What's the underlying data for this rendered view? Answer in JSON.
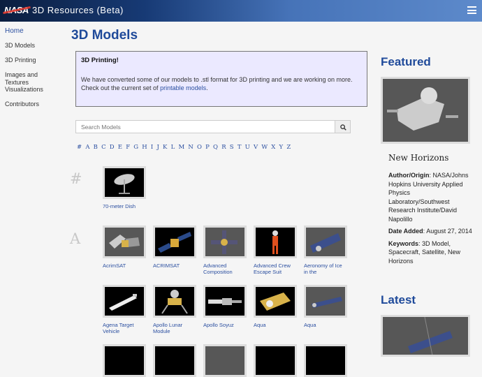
{
  "header": {
    "logo": "NASA",
    "title": "3D Resources (Beta)"
  },
  "sidebar": {
    "items": [
      {
        "label": "Home"
      },
      {
        "label": "3D Models"
      },
      {
        "label": "3D Printing"
      },
      {
        "label": "Images and Textures"
      },
      {
        "label": "Visualizations"
      },
      {
        "label": "Contributors"
      }
    ]
  },
  "main": {
    "title": "3D Models",
    "alert": {
      "heading": "3D Printing!",
      "text": "We have converted some of our models to .stl format for 3D printing and we are working on more. Check out the current set of",
      "link": "printable models",
      "end": "."
    },
    "search": {
      "placeholder": "Search Models"
    },
    "alphabet": [
      "#",
      "A",
      "B",
      "C",
      "D",
      "E",
      "F",
      "G",
      "H",
      "I",
      "J",
      "K",
      "L",
      "M",
      "N",
      "O",
      "P",
      "Q",
      "R",
      "S",
      "T",
      "U",
      "V",
      "W",
      "X",
      "Y",
      "Z"
    ],
    "sections": [
      {
        "letter": "#",
        "models": [
          {
            "name": "70-meter Dish"
          }
        ]
      },
      {
        "letter": "A",
        "models": [
          {
            "name": "AcrimSAT"
          },
          {
            "name": "ACRIMSAT"
          },
          {
            "name": "Advanced Composition"
          },
          {
            "name": "Advanced Crew Escape Suit"
          },
          {
            "name": "Aeronomy of Ice in the"
          },
          {
            "name": "Agena Target Vehicle"
          },
          {
            "name": "Apollo Lunar Module"
          },
          {
            "name": "Apollo Soyuz"
          },
          {
            "name": "Aqua"
          },
          {
            "name": "Aqua"
          }
        ]
      }
    ]
  },
  "featured": {
    "heading": "Featured",
    "name": "New Horizons",
    "author_label": "Author/Origin",
    "author": "NASA/Johns Hopkins University Applied Physics Laboratory/Southwest Research Institute/David Napolillo",
    "date_label": "Date Added",
    "date": "August 27, 2014",
    "keywords_label": "Keywords",
    "keywords": "3D Model, Spacecraft, Satellite, New Horizons"
  },
  "latest": {
    "heading": "Latest"
  },
  "colors": {
    "accent": "#1f4a9a",
    "link": "#2b4fa0",
    "alert_bg": "#ebe9ff"
  }
}
